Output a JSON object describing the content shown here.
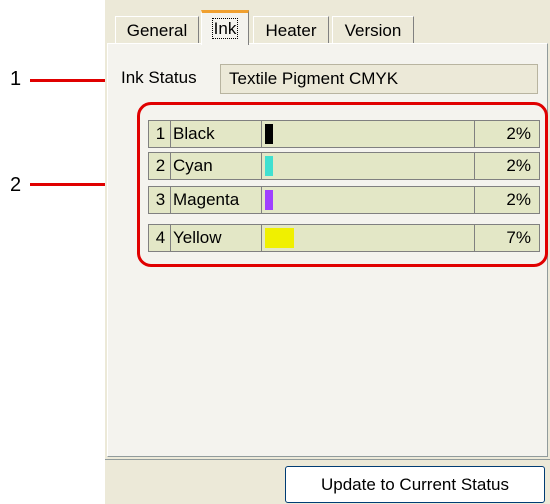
{
  "tabs": [
    "General",
    "Ink",
    "Heater",
    "Version"
  ],
  "ink_status": {
    "label": "Ink Status",
    "value": "Textile Pigment CMYK"
  },
  "inks": [
    {
      "num": "1",
      "name": "Black",
      "percent": "2%",
      "level": 0.02,
      "color": "#000000"
    },
    {
      "num": "2",
      "name": "Cyan",
      "percent": "2%",
      "level": 0.02,
      "color": "#40e0d0"
    },
    {
      "num": "3",
      "name": "Magenta",
      "percent": "2%",
      "level": 0.02,
      "color": "#a040ff"
    },
    {
      "num": "4",
      "name": "Yellow",
      "percent": "7%",
      "level": 0.07,
      "color": "#f0f000"
    }
  ],
  "update_button": "Update to Current Status",
  "callouts": [
    "1",
    "2"
  ],
  "accent_color": "#e00000"
}
